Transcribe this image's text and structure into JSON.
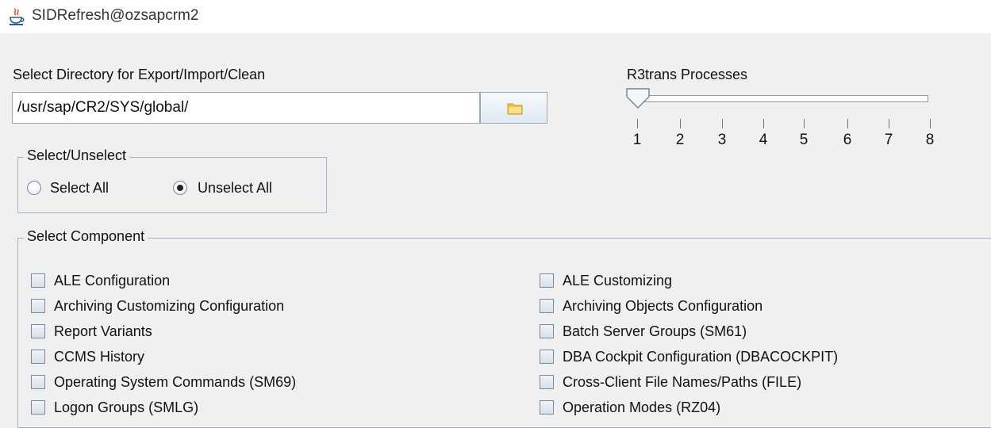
{
  "window": {
    "title": "SIDRefresh@ozsapcrm2",
    "icon": "java-cup-icon"
  },
  "directory": {
    "label": "Select Directory for Export/Import/Clean",
    "path": "/usr/sap/CR2/SYS/global/",
    "browse_icon": "folder-icon"
  },
  "r3trans": {
    "label": "R3trans Processes",
    "value": 1,
    "min": 1,
    "max": 8,
    "ticks": [
      "1",
      "2",
      "3",
      "4",
      "5",
      "6",
      "7",
      "8"
    ]
  },
  "select_unselect": {
    "title": "Select/Unselect",
    "options": [
      {
        "label": "Select All",
        "selected": false
      },
      {
        "label": "Unselect All",
        "selected": true
      }
    ]
  },
  "components": {
    "title": "Select Component",
    "left": [
      {
        "label": "ALE Configuration",
        "checked": false
      },
      {
        "label": "Archiving Customizing Configuration",
        "checked": false
      },
      {
        "label": "Report Variants",
        "checked": false
      },
      {
        "label": "CCMS History",
        "checked": false
      },
      {
        "label": "Operating System Commands (SM69)",
        "checked": false
      },
      {
        "label": "Logon Groups (SMLG)",
        "checked": false
      }
    ],
    "right": [
      {
        "label": "ALE Customizing",
        "checked": false
      },
      {
        "label": "Archiving Objects Configuration",
        "checked": false
      },
      {
        "label": "Batch Server Groups (SM61)",
        "checked": false
      },
      {
        "label": "DBA Cockpit Configuration (DBACOCKPIT)",
        "checked": false
      },
      {
        "label": "Cross-Client File Names/Paths (FILE)",
        "checked": false
      },
      {
        "label": "Operation Modes (RZ04)",
        "checked": false
      }
    ]
  }
}
